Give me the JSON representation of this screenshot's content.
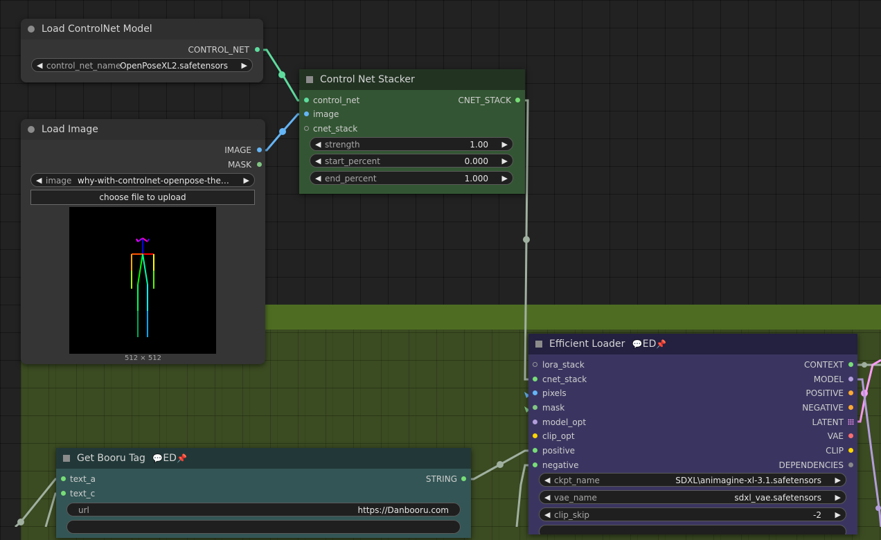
{
  "colors": {
    "canvas_bg": "#222222",
    "group_bg": "#506e23",
    "control_net": "#5edc9e",
    "image": "#64b5f6",
    "mask": "#81c784",
    "model": "#b39ddb",
    "clip": "#ffd500",
    "conditioning": "#ffa931",
    "vae": "#ff6e6e",
    "latent": "#ff9cf9",
    "string": "#77dd77",
    "cnet_stack_wire": "#a0b0a0"
  },
  "load_controlnet": {
    "title": "Load ControlNet Model",
    "output_control_net": "CONTROL_NET",
    "widget_name": "control_net_name",
    "widget_value": "OpenPoseXL2.safetensors"
  },
  "load_image": {
    "title": "Load Image",
    "output_image": "IMAGE",
    "output_mask": "MASK",
    "widget_name": "image",
    "widget_value": "why-with-controlnet-openpose-the-f...",
    "upload_button": "choose file to upload",
    "image_size": "512 × 512",
    "preview_alt": "openpose skeleton"
  },
  "cnet_stacker": {
    "title": "Control Net Stacker",
    "inputs": [
      "control_net",
      "image",
      "cnet_stack"
    ],
    "output": "CNET_STACK",
    "widgets": [
      {
        "name": "strength",
        "value": "1.00"
      },
      {
        "name": "start_percent",
        "value": "0.000"
      },
      {
        "name": "end_percent",
        "value": "1.000"
      }
    ]
  },
  "efficient_loader": {
    "title": "Efficient Loader",
    "badge": "ED",
    "badge_icon": "speech-bubble-icon",
    "pin_icon": "pin-icon",
    "inputs": [
      "lora_stack",
      "cnet_stack",
      "pixels",
      "mask",
      "model_opt",
      "clip_opt",
      "positive",
      "negative"
    ],
    "outputs": [
      "CONTEXT",
      "MODEL",
      "POSITIVE",
      "NEGATIVE",
      "LATENT",
      "VAE",
      "CLIP",
      "DEPENDENCIES"
    ],
    "widgets": [
      {
        "name": "ckpt_name",
        "value": "SDXL\\animagine-xl-3.1.safetensors"
      },
      {
        "name": "vae_name",
        "value": "sdxl_vae.safetensors"
      },
      {
        "name": "clip_skip",
        "value": "-2"
      }
    ]
  },
  "get_booru_tag": {
    "title": "Get Booru Tag",
    "badge": "ED",
    "inputs": [
      "text_a",
      "text_c"
    ],
    "output": "STRING",
    "widget_name": "url",
    "widget_value": "https://Danbooru.com"
  }
}
